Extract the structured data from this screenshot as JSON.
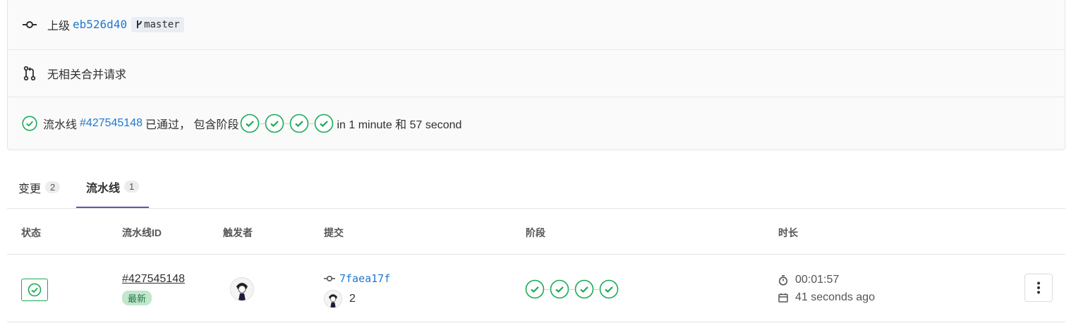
{
  "info": {
    "parent_label": "上级",
    "parent_hash": "eb526d40",
    "branch": "master",
    "mr_text": "无相关合并请求",
    "pipeline_prefix": "流水线",
    "pipeline_id": "#427545148",
    "pipeline_status_text": "已通过， 包含阶段",
    "pipeline_duration_text": "in 1 minute 和 57 second"
  },
  "tabs": [
    {
      "label": "变更",
      "count": "2"
    },
    {
      "label": "流水线",
      "count": "1"
    }
  ],
  "table": {
    "headers": [
      "状态",
      "流水线ID",
      "触发者",
      "提交",
      "阶段",
      "时长"
    ],
    "row": {
      "pipeline_id": "#427545148",
      "badge": "最新",
      "commit_hash": "7faea17f",
      "commit_count": "2",
      "duration": "00:01:57",
      "finished": "41 seconds ago"
    }
  },
  "colors": {
    "success": "#1aaa55",
    "link": "#1f78d1",
    "tab_active": "#6b4fbb"
  },
  "icons": [
    "commit-icon",
    "branch-icon",
    "merge-request-icon",
    "status-success-icon",
    "timer-icon",
    "calendar-icon",
    "kebab-icon"
  ]
}
